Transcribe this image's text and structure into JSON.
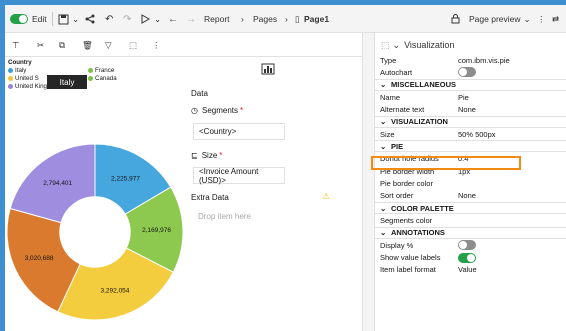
{
  "toolbar": {
    "edit_label": "Edit",
    "breadcrumb": {
      "report": "Report",
      "pages": "Pages",
      "page1": "Page1"
    },
    "page_preview": "Page preview"
  },
  "data_panel": {
    "title": "Data",
    "segments_label": "Segments",
    "segments_value": "<Country>",
    "size_label": "Size",
    "size_value": "<Invoice Amount (USD)>",
    "extra_label": "Extra Data",
    "extra_placeholder": "Drop item here"
  },
  "properties": {
    "header": "Visualization",
    "rows": [
      {
        "label": "Type",
        "value": "com.ibm.vis.pie",
        "kind": "row"
      },
      {
        "label": "Autochart",
        "value": "",
        "kind": "toggle-off"
      },
      {
        "label": "MISCELLANEOUS",
        "kind": "section"
      },
      {
        "label": "Name",
        "value": "Pie",
        "kind": "row"
      },
      {
        "label": "Alternate text",
        "value": "None",
        "kind": "row"
      },
      {
        "label": "VISUALIZATION",
        "kind": "section"
      },
      {
        "label": "Size",
        "value": "50% 500px",
        "kind": "row"
      },
      {
        "label": "PIE",
        "kind": "section"
      },
      {
        "label": "Donut hole radius",
        "value": "0.4",
        "kind": "row"
      },
      {
        "label": "Pie border width",
        "value": "1px",
        "kind": "row"
      },
      {
        "label": "Pie border color",
        "value": "",
        "kind": "row"
      },
      {
        "label": "Sort order",
        "value": "None",
        "kind": "row"
      },
      {
        "label": "COLOR PALETTE",
        "kind": "section"
      },
      {
        "label": "Segments color",
        "value": "",
        "kind": "row"
      },
      {
        "label": "ANNOTATIONS",
        "kind": "section"
      },
      {
        "label": "Display %",
        "value": "",
        "kind": "toggle-off"
      },
      {
        "label": "Show value labels",
        "value": "",
        "kind": "toggle-on"
      },
      {
        "label": "Item label format",
        "value": "Value",
        "kind": "row"
      }
    ]
  },
  "legend": {
    "title": "Country",
    "items": [
      {
        "label": "Italy",
        "color": "#3f9fdb"
      },
      {
        "label": "France",
        "color": "#7bc143"
      },
      {
        "label": "United S",
        "color": "#f0c43a"
      },
      {
        "label": "Canada",
        "color": "#7bc143"
      },
      {
        "label": "United Kingdom",
        "color": "#9b82d8"
      }
    ]
  },
  "tooltip": "Italy",
  "chart_data": {
    "type": "pie",
    "donut_hole_radius": 0.4,
    "slices": [
      {
        "label": "Italy",
        "value": 2225977,
        "text": "2,225,977",
        "color": "#46a6de"
      },
      {
        "label": "France",
        "value": 2169976,
        "text": "2,169,976",
        "color": "#8ec94f"
      },
      {
        "label": "United States",
        "value": 3292054,
        "text": "3,292,054",
        "color": "#f3cd3e"
      },
      {
        "label": "Canada",
        "value": 3020688,
        "text": "3,020,688",
        "color": "#d97a2e"
      },
      {
        "label": "United Kingdom",
        "value": 2794401,
        "text": "2,794,401",
        "color": "#9f8ddf"
      }
    ]
  }
}
